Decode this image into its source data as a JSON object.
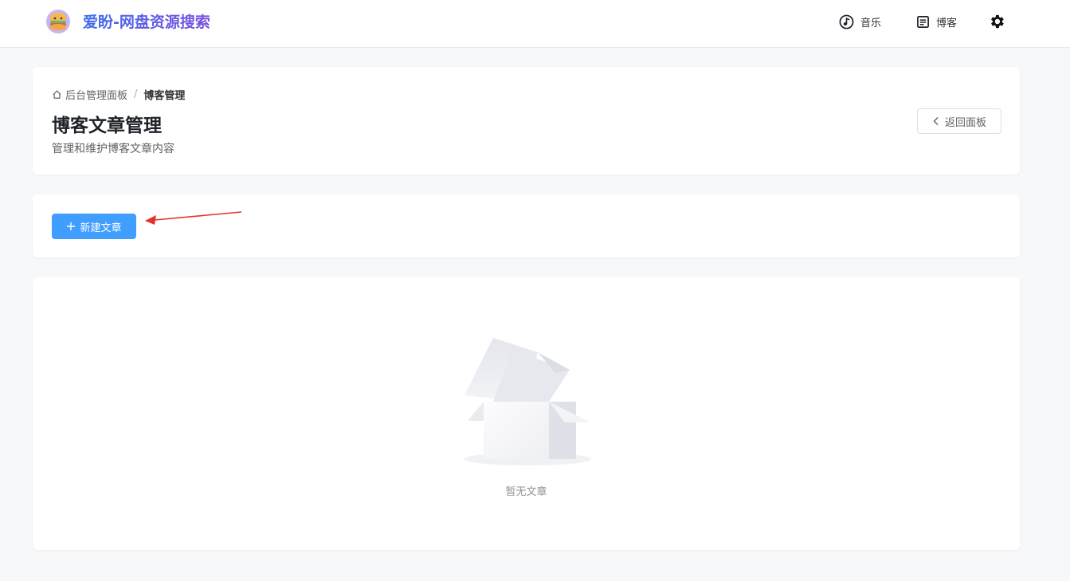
{
  "header": {
    "brand": "爱盼-网盘资源搜索",
    "nav": {
      "music_label": "音乐",
      "blog_label": "博客"
    },
    "icons": {
      "logo": "burger-mascot-logo",
      "music": "music-icon",
      "blog": "document-icon",
      "settings": "gear-icon"
    }
  },
  "breadcrumb": {
    "root": "后台管理面板",
    "separator": "/",
    "current": "博客管理"
  },
  "page": {
    "title": "博客文章管理",
    "subtitle": "管理和维护博客文章内容",
    "back_label": "返回面板"
  },
  "toolbar": {
    "new_label": "新建文章"
  },
  "list": {
    "empty_text": "暂无文章"
  },
  "colors": {
    "primary": "#409eff",
    "brand_gradient_start": "#3f6cf0",
    "brand_gradient_end": "#7a4fe0",
    "annotation_arrow": "#e8302a",
    "page_bg": "#f7f8fa"
  }
}
